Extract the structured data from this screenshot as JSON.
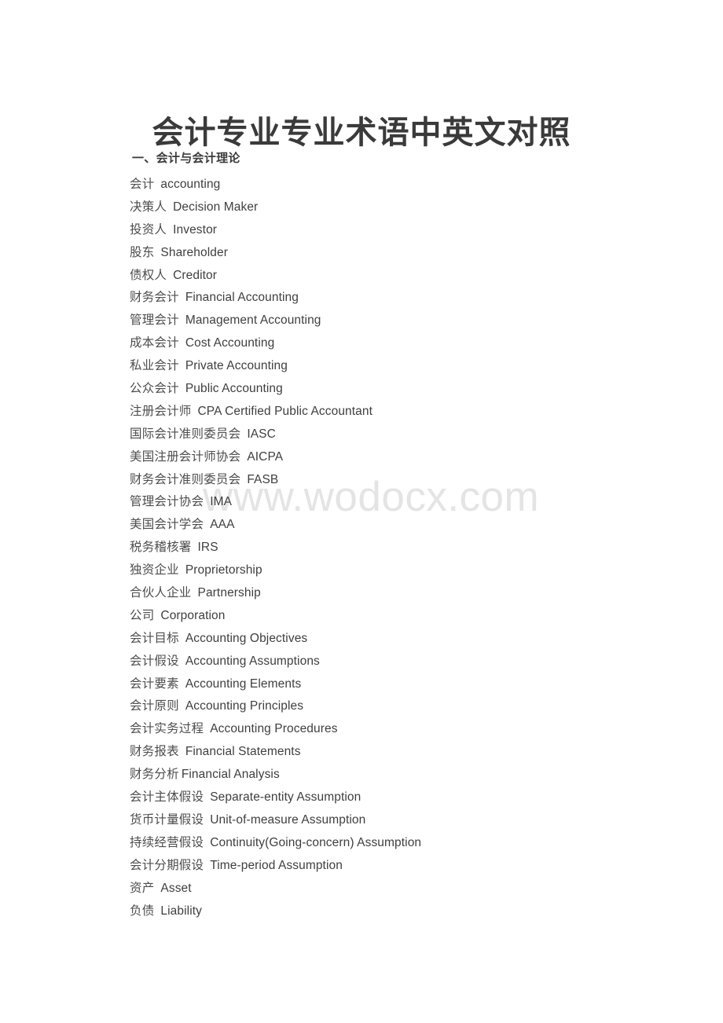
{
  "document": {
    "title": "会计专业专业术语中英文对照",
    "watermark": "www.wodocx.com",
    "section_heading": "一、会计与会计理论",
    "terms": [
      {
        "zh": "会计",
        "en": "accounting",
        "gap": "wide"
      },
      {
        "zh": "决策人",
        "en": "Decision Maker",
        "gap": "wide"
      },
      {
        "zh": "投资人",
        "en": "Investor",
        "gap": "wide"
      },
      {
        "zh": "股东",
        "en": "Shareholder",
        "gap": "wide"
      },
      {
        "zh": "债权人",
        "en": "Creditor",
        "gap": "wide"
      },
      {
        "zh": "财务会计",
        "en": "Financial Accounting",
        "gap": "wide"
      },
      {
        "zh": "管理会计",
        "en": "Management Accounting",
        "gap": "wide"
      },
      {
        "zh": "成本会计",
        "en": "Cost Accounting",
        "gap": "wide"
      },
      {
        "zh": "私业会计",
        "en": "Private Accounting",
        "gap": "wide"
      },
      {
        "zh": "公众会计",
        "en": "Public Accounting",
        "gap": "wide"
      },
      {
        "zh": "注册会计师",
        "en": "CPA Certified Public Accountant",
        "gap": "wide"
      },
      {
        "zh": "国际会计准则委员会",
        "en": "IASC",
        "gap": "wide"
      },
      {
        "zh": "美国注册会计师协会",
        "en": "AICPA",
        "gap": "wide"
      },
      {
        "zh": "财务会计准则委员会",
        "en": "FASB",
        "gap": "wide"
      },
      {
        "zh": "管理会计协会",
        "en": "IMA",
        "gap": "wide"
      },
      {
        "zh": "美国会计学会",
        "en": "AAA",
        "gap": "wide"
      },
      {
        "zh": "税务稽核署",
        "en": "IRS",
        "gap": "wide"
      },
      {
        "zh": "独资企业",
        "en": "Proprietorship",
        "gap": "wide"
      },
      {
        "zh": "合伙人企业",
        "en": "Partnership",
        "gap": "wide"
      },
      {
        "zh": "公司",
        "en": "Corporation",
        "gap": "wide"
      },
      {
        "zh": "会计目标",
        "en": "Accounting Objectives",
        "gap": "wide"
      },
      {
        "zh": "会计假设",
        "en": "Accounting Assumptions",
        "gap": "wide"
      },
      {
        "zh": "会计要素",
        "en": "Accounting Elements",
        "gap": "wide"
      },
      {
        "zh": "会计原则",
        "en": "Accounting Principles",
        "gap": "wide"
      },
      {
        "zh": "会计实务过程",
        "en": "Accounting Procedures",
        "gap": "wide"
      },
      {
        "zh": "财务报表",
        "en": "Financial Statements",
        "gap": "wide"
      },
      {
        "zh": "财务分析",
        "en": "Financial Analysis",
        "gap": "narrow"
      },
      {
        "zh": "会计主体假设",
        "en": "Separate-entity Assumption",
        "gap": "wide"
      },
      {
        "zh": "货币计量假设",
        "en": "Unit-of-measure Assumption",
        "gap": "wide"
      },
      {
        "zh": "持续经营假设",
        "en": "Continuity(Going-concern) Assumption",
        "gap": "wide"
      },
      {
        "zh": "会计分期假设",
        "en": "Time-period Assumption",
        "gap": "wide"
      },
      {
        "zh": "资产",
        "en": "Asset",
        "gap": "wide"
      },
      {
        "zh": "负债",
        "en": "Liability",
        "gap": "wide"
      }
    ]
  }
}
